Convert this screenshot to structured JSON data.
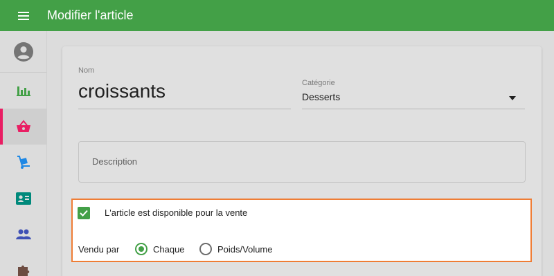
{
  "header": {
    "menu_icon": "hamburger-menu-icon",
    "title": "Modifier l'article",
    "color": "#43a047"
  },
  "sidebar": {
    "items": [
      {
        "icon": "account-circle-icon",
        "active": false
      },
      {
        "icon": "bar-chart-icon",
        "active": false
      },
      {
        "icon": "shopping-basket-icon",
        "active": true
      },
      {
        "icon": "hand-truck-icon",
        "active": false
      },
      {
        "icon": "contact-card-icon",
        "active": false
      },
      {
        "icon": "people-icon",
        "active": false
      },
      {
        "icon": "puzzle-icon",
        "active": false
      }
    ],
    "active_color": "#e91e63"
  },
  "form": {
    "name": {
      "label": "Nom",
      "value": "croissants"
    },
    "category": {
      "label": "Catégorie",
      "value": "Desserts"
    },
    "description": {
      "placeholder": "Description"
    },
    "available": {
      "label": "L'article est disponible pour la vente",
      "checked": true
    },
    "sold_by": {
      "label": "Vendu par",
      "options": [
        {
          "label": "Chaque",
          "selected": true
        },
        {
          "label": "Poids/Volume",
          "selected": false
        }
      ]
    }
  },
  "highlight_color": "#ef7d35"
}
